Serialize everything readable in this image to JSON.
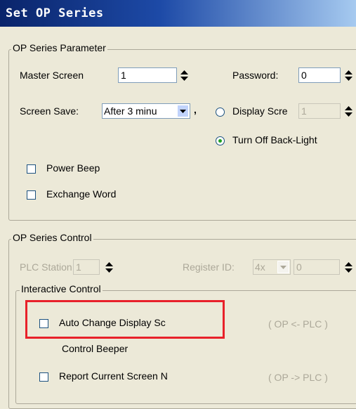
{
  "window": {
    "title": "Set OP Series"
  },
  "op_series_parameter": {
    "group_label": "OP Series Parameter",
    "master_screen": {
      "label": "Master Screen",
      "value": "1"
    },
    "password": {
      "label": "Password:",
      "value": "0"
    },
    "screen_save": {
      "label": "Screen Save:",
      "selected": "After 3 minu",
      "comma": ","
    },
    "display_screen": {
      "label": "Display Scre",
      "value": "1"
    },
    "turn_off_backlight": {
      "label": "Turn Off Back-Light",
      "selected": true
    },
    "power_beep": {
      "label": "Power Beep",
      "checked": false
    },
    "exchange_word": {
      "label": "Exchange Word",
      "checked": false
    }
  },
  "op_series_control": {
    "group_label": "OP Series Control",
    "plc_station": {
      "label": "PLC Station",
      "value": "1"
    },
    "register_id": {
      "label": "Register ID:",
      "type_selected": "4x",
      "value": "0"
    },
    "interactive_control": {
      "group_label": "Interactive Control",
      "auto_change_display": {
        "label": "Auto Change Display Sc",
        "checked": false,
        "direction": "( OP <- PLC )"
      },
      "control_beeper": {
        "label": "Control Beeper"
      },
      "report_current_screen": {
        "label": "Report Current Screen N",
        "checked": false,
        "direction": "( OP -> PLC )"
      }
    }
  },
  "highlight_color": "#e8212a"
}
